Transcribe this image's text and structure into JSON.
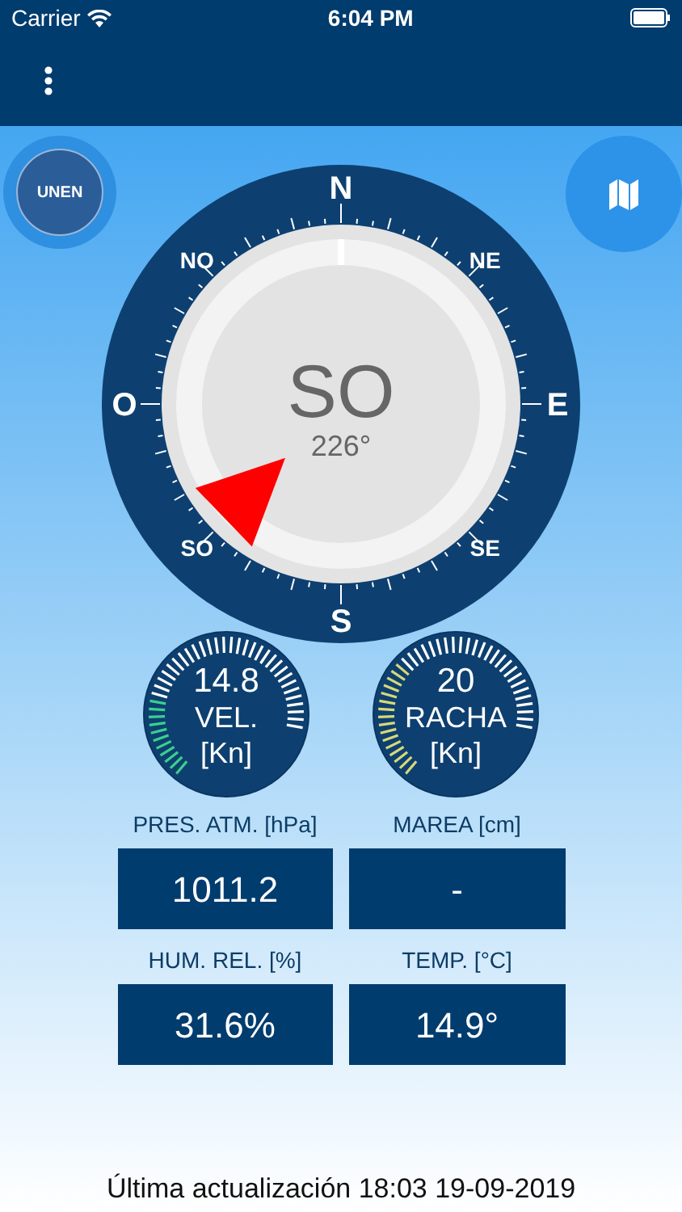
{
  "status_bar": {
    "carrier": "Carrier",
    "time": "6:04 PM"
  },
  "logo": {
    "text": "UNEN"
  },
  "compass": {
    "cardinals": [
      "N",
      "NE",
      "E",
      "SE",
      "S",
      "SO",
      "O",
      "NO"
    ],
    "direction": "SO",
    "degrees": "226°"
  },
  "gauges": [
    {
      "value": "14.8",
      "label": "VEL.",
      "unit": "[Kn]",
      "color": "#3ccf8e"
    },
    {
      "value": "20",
      "label": "RACHA",
      "unit": "[Kn]",
      "color": "#d8d878"
    }
  ],
  "stats": [
    {
      "label": "PRES. ATM. [hPa]",
      "value": "1011.2"
    },
    {
      "label": "MAREA [cm]",
      "value": "-"
    },
    {
      "label": "HUM. REL. [%]",
      "value": "31.6%"
    },
    {
      "label": "TEMP. [°C]",
      "value": "14.9°"
    }
  ],
  "footer": "Última actualización 18:03 19-09-2019"
}
